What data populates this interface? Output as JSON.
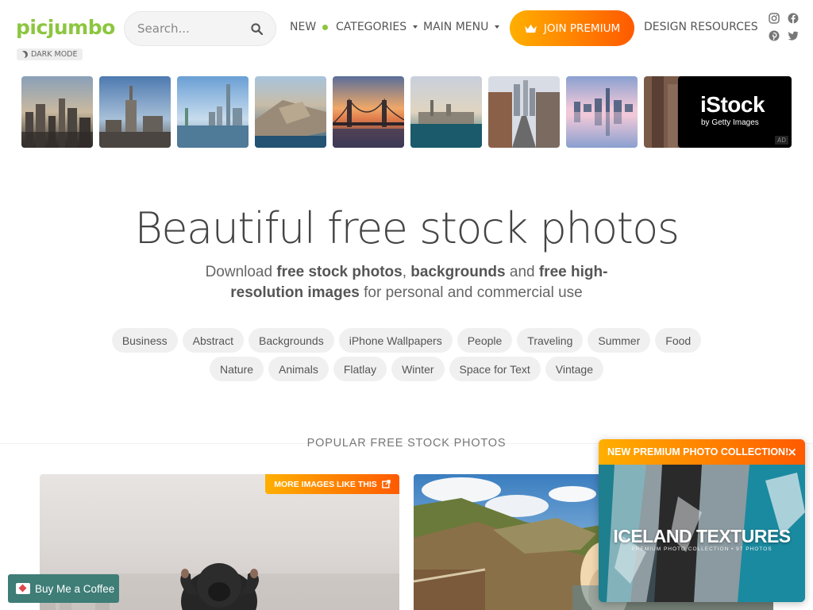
{
  "header": {
    "logo": "picjumbo",
    "dark_mode_label": "DARK MODE",
    "search_placeholder": "Search...",
    "nav": {
      "new": "NEW",
      "categories": "CATEGORIES",
      "main_menu": "MAIN MENU",
      "join_premium": "JOIN PREMIUM",
      "design_resources": "DESIGN RESOURCES"
    },
    "social_icons": [
      "instagram-icon",
      "facebook-icon",
      "pinterest-icon",
      "twitter-icon"
    ]
  },
  "ad": {
    "brand": "iStock",
    "byline": "by Getty Images",
    "tag": "AD"
  },
  "hero": {
    "title": "Beautiful free stock photos",
    "sub_1": "Download ",
    "sub_b1": "free stock photos",
    "sub_2": ", ",
    "sub_b2": "backgrounds",
    "sub_3": " and ",
    "sub_b3": "free high-resolution images",
    "sub_4": " for personal and commercial use"
  },
  "tags_row1": [
    "Business",
    "Abstract",
    "Backgrounds",
    "iPhone Wallpapers",
    "People",
    "Traveling",
    "Summer",
    "Food"
  ],
  "tags_row2": [
    "Nature",
    "Animals",
    "Flatlay",
    "Winter",
    "Space for Text",
    "Vintage"
  ],
  "section_title": "POPULAR FREE STOCK PHOTOS",
  "more_images": "MORE IMAGES LIKE THIS",
  "popup": {
    "header": "NEW PREMIUM PHOTO COLLECTION!",
    "close": "×",
    "title": "ICELAND TEXTURES",
    "subtitle": "PREMIUM PHOTO COLLECTION • 97 PHOTOS"
  },
  "coffee_button": "Buy Me a Coffee",
  "colors": {
    "brand_green": "#8cc63f",
    "premium_start": "#ffaf00",
    "premium_end": "#ff5a00",
    "coffee_bg": "#3f7d77"
  }
}
